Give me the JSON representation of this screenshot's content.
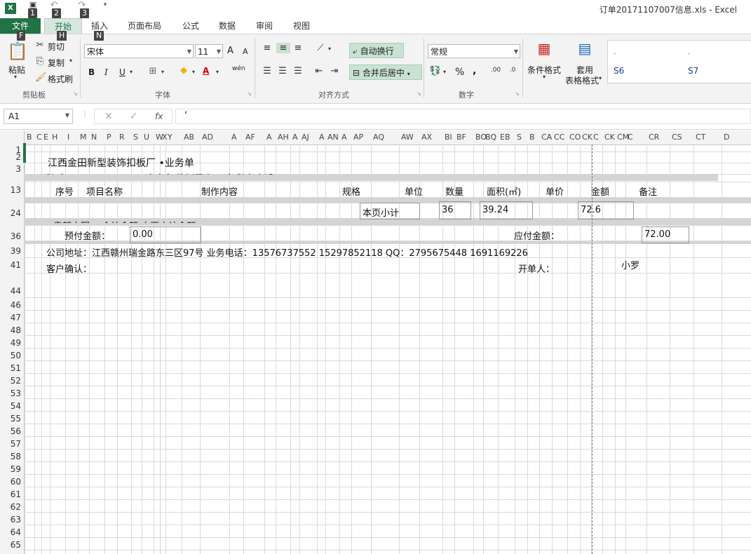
{
  "title": "订单20171107007信息.xls - Excel",
  "keytips": {
    "save": "1",
    "undo": "2",
    "redo": "3",
    "file": "F",
    "home": "H",
    "insert": "N"
  },
  "tabs": {
    "file": "文件",
    "home": "开始",
    "insert": "插入",
    "layout": "页面布局",
    "formula": "公式",
    "data": "数据",
    "review": "审阅",
    "view": "视图"
  },
  "ribbon": {
    "paste": "粘贴",
    "cut": "剪切",
    "copy": "复制",
    "format_painter": "格式刷",
    "clipboard": "剪贴板",
    "font_name": "宋体",
    "font_size": "11",
    "font_group": "字体",
    "bold": "B",
    "italic": "I",
    "underline": "U",
    "grow": "A",
    "shrink": "A",
    "wen": "wén",
    "wrap_text": "自动换行",
    "merge_center": "合并后居中",
    "align_group": "对齐方式",
    "number_format": "常规",
    "number_group": "数字",
    "percent": "%",
    "comma": ",",
    "cond_format": "条件格式",
    "table_format_1": "套用",
    "table_format_2": "表格格式",
    "style1": "S6",
    "style2": "S7"
  },
  "formula_bar": {
    "name_box": "A1",
    "fx": "fx",
    "content": "'"
  },
  "columns": [
    "B",
    "C",
    "E",
    "H",
    "I",
    "M",
    "N",
    "P",
    "R",
    "S",
    "U",
    "W",
    "X",
    "Y",
    "AB",
    "AD",
    "A",
    "AF",
    "A",
    "AH",
    "A",
    "AJ",
    "A",
    "AN",
    "A",
    "AP",
    "AQ",
    "AW",
    "AX",
    "BI",
    "BF",
    "BO",
    "BQ",
    "EB",
    "S",
    "B",
    "CA",
    "CC",
    "CO",
    "CK",
    "C",
    "CK",
    "CM",
    "C",
    "CR",
    "CS",
    "CT",
    "D"
  ],
  "rows": [
    "1",
    "2",
    "3",
    "13",
    "24",
    "36",
    "39",
    "41",
    "44",
    "46",
    "47",
    "48",
    "49",
    "50",
    "51",
    "52",
    "53",
    "54",
    "55",
    "56",
    "57",
    "58",
    "59",
    "60",
    "61",
    "62",
    "63",
    "64",
    "65"
  ],
  "sheet": {
    "heading": "江西金田新型装饰扣板厂 •业务单",
    "partial_row": "肚  务  A    20171107007            客户名    柳树园人工 宗                            肚务电话：  139 7857 3855",
    "hdr_no": "序号",
    "hdr_item": "项目名称",
    "hdr_content": "制作内容",
    "hdr_spec": "规格",
    "hdr_unit": "单位",
    "hdr_qty": "数量",
    "hdr_area": "面积(㎡)",
    "hdr_price": "单价",
    "hdr_amount": "金额",
    "hdr_note": "备注",
    "subtotal_label": "本页小计",
    "subtotal_qty": "36",
    "subtotal_area": "39.24",
    "subtotal_amount": "72.6",
    "partial_row2": "贵额大写：                合计金额                                           本页小计金额：",
    "prepaid_label": "预付金额：",
    "prepaid_value": "0.00",
    "payable_label": "应付金额：",
    "payable_value": "72.00",
    "address": "公司地址：江西赣州瑞金路东三区97号    业务电话：13576737552  15297852118     QQ：2795675448  1691169226",
    "customer_confirm": "客户确认：",
    "issuer_label": "开单人：",
    "issuer_name": "小罗"
  }
}
